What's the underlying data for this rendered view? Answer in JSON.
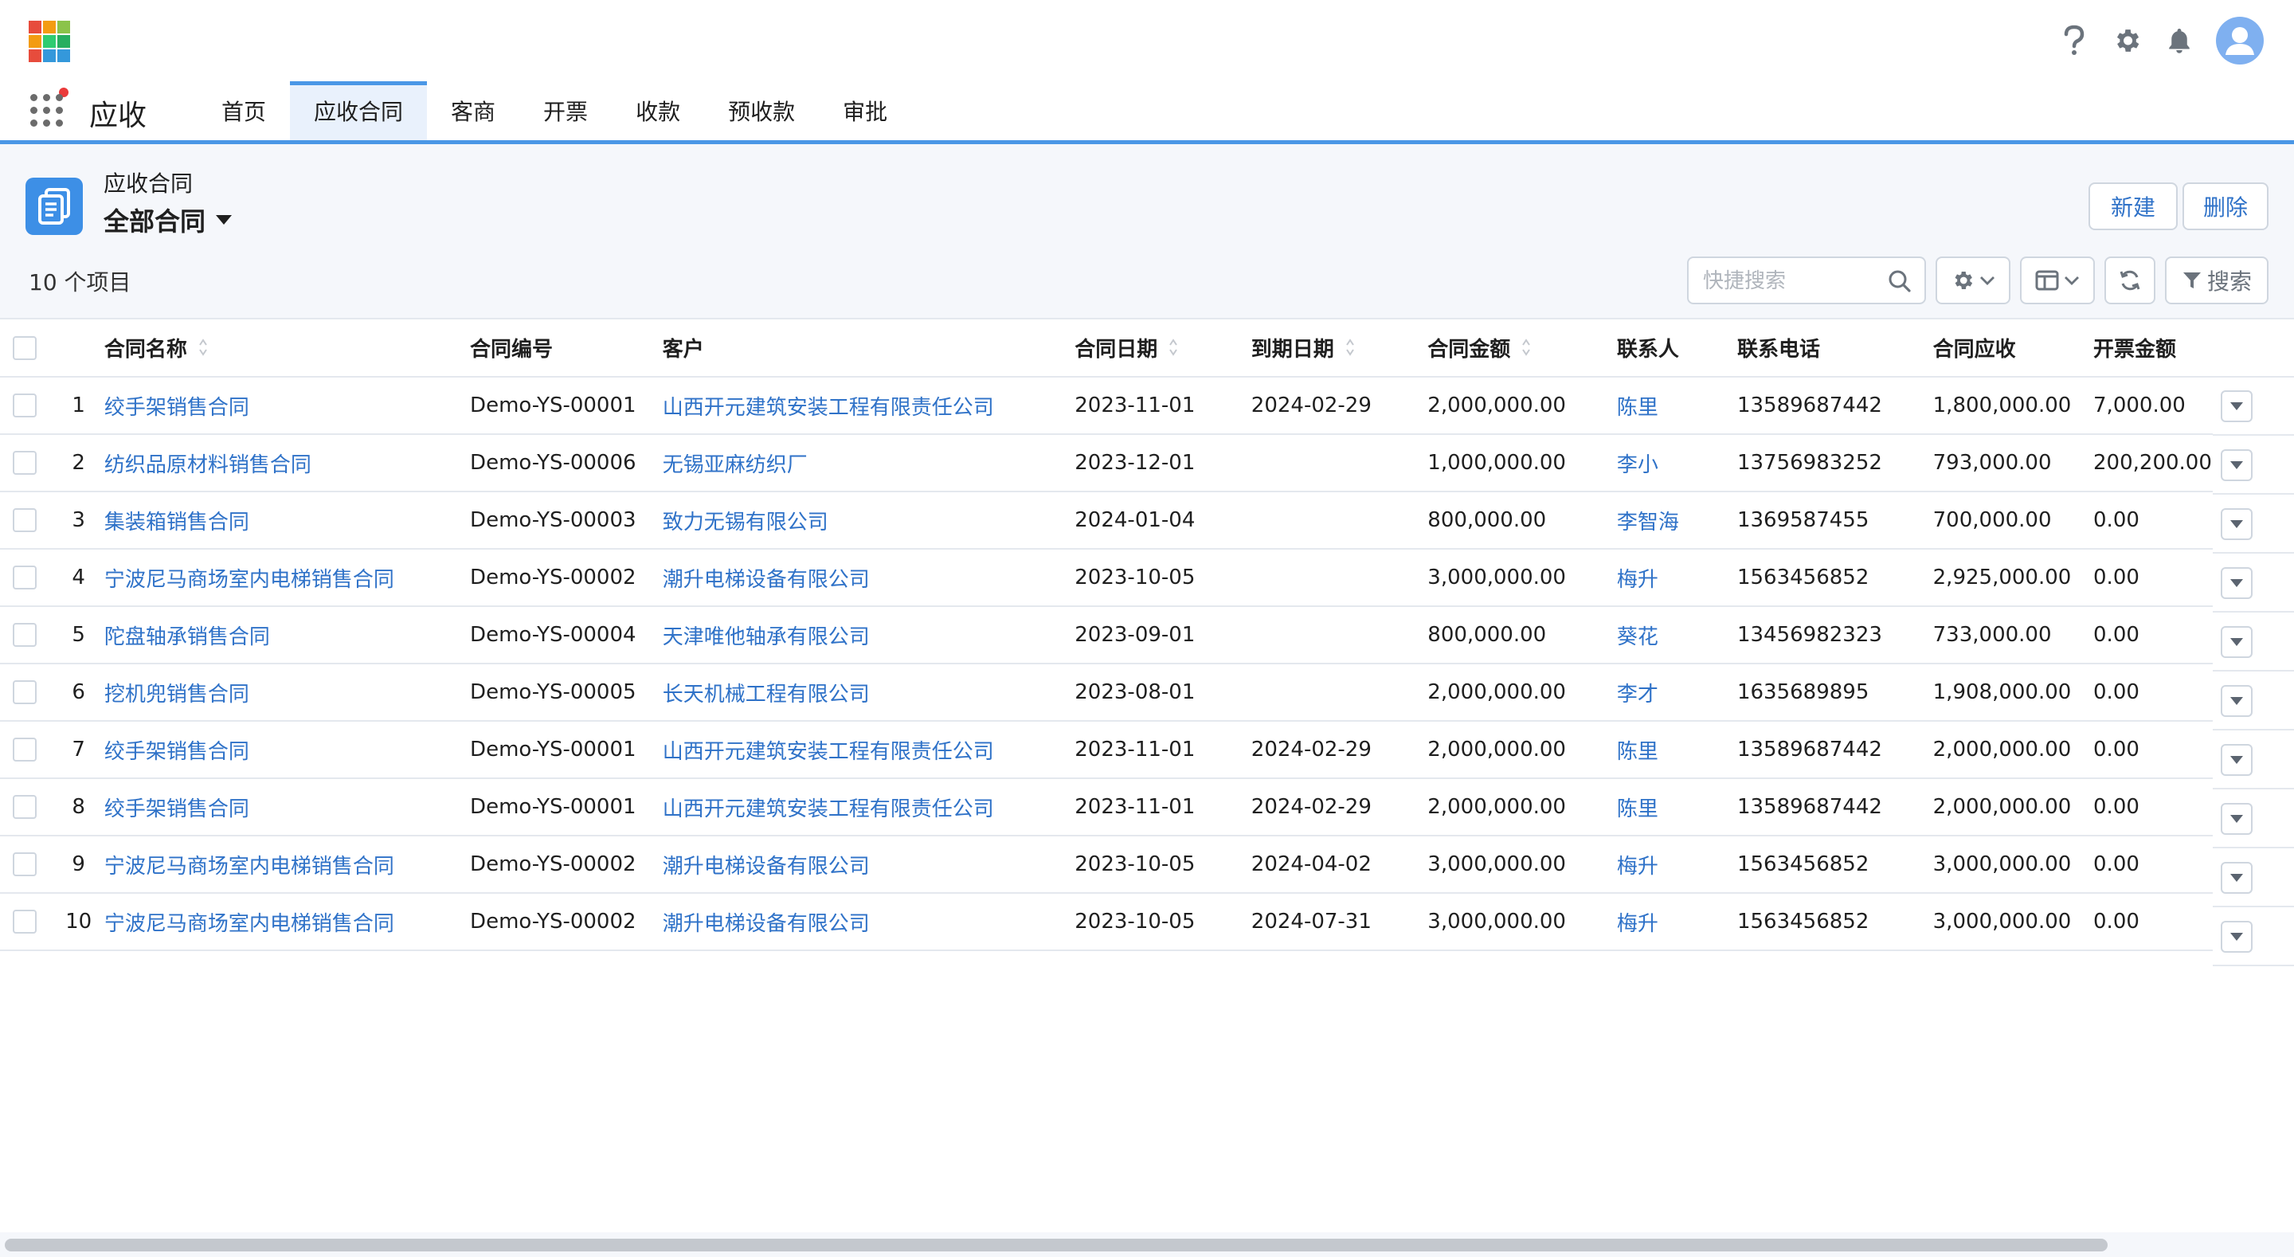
{
  "app": {
    "name": "应收",
    "logo_colors": [
      "#e74c3c",
      "#f39c12",
      "#8bc34a",
      "#f39c12",
      "#2ecc71",
      "#27ae60",
      "#e74c3c",
      "#3498db",
      "#3498db"
    ],
    "accent": "#4a97e6"
  },
  "header": {
    "icons": [
      "help-icon",
      "gear-icon",
      "bell-icon",
      "user-avatar-icon"
    ]
  },
  "tabs": [
    {
      "label": "首页",
      "active": false
    },
    {
      "label": "应收合同",
      "active": true
    },
    {
      "label": "客商",
      "active": false
    },
    {
      "label": "开票",
      "active": false
    },
    {
      "label": "收款",
      "active": false
    },
    {
      "label": "预收款",
      "active": false
    },
    {
      "label": "审批",
      "active": false
    }
  ],
  "page": {
    "object_type": "应收合同",
    "view_name": "全部合同",
    "item_count": "10 个项目",
    "new_label": "新建",
    "delete_label": "删除",
    "search_placeholder": "快捷搜索",
    "search_value": "",
    "filter_label": "搜索"
  },
  "table": {
    "columns": [
      "合同名称",
      "合同编号",
      "客户",
      "合同日期",
      "到期日期",
      "合同金额",
      "联系人",
      "联系电话",
      "合同应收",
      "开票金额"
    ],
    "sortable": [
      true,
      false,
      false,
      true,
      true,
      true,
      false,
      false,
      false,
      false
    ],
    "rows": [
      {
        "num": "1",
        "name": "绞手架销售合同",
        "code": "Demo-YS-00001",
        "customer": "山西开元建筑安装工程有限责任公司",
        "date": "2023-11-01",
        "due": "2024-02-29",
        "amount": "2,000,000.00",
        "contact": "陈里",
        "phone": "13589687442",
        "receivable": "1,800,000.00",
        "invoiced": "7,000.00"
      },
      {
        "num": "2",
        "name": "纺织品原材料销售合同",
        "code": "Demo-YS-00006",
        "customer": "无锡亚麻纺织厂",
        "date": "2023-12-01",
        "due": "",
        "amount": "1,000,000.00",
        "contact": "李小",
        "phone": "13756983252",
        "receivable": "793,000.00",
        "invoiced": "200,200.00"
      },
      {
        "num": "3",
        "name": "集装箱销售合同",
        "code": "Demo-YS-00003",
        "customer": "致力无锡有限公司",
        "date": "2024-01-04",
        "due": "",
        "amount": "800,000.00",
        "contact": "李智海",
        "phone": "1369587455",
        "receivable": "700,000.00",
        "invoiced": "0.00"
      },
      {
        "num": "4",
        "name": "宁波尼马商场室内电梯销售合同",
        "code": "Demo-YS-00002",
        "customer": "潮升电梯设备有限公司",
        "date": "2023-10-05",
        "due": "",
        "amount": "3,000,000.00",
        "contact": "梅升",
        "phone": "1563456852",
        "receivable": "2,925,000.00",
        "invoiced": "0.00"
      },
      {
        "num": "5",
        "name": "陀盘轴承销售合同",
        "code": "Demo-YS-00004",
        "customer": "天津唯他轴承有限公司",
        "date": "2023-09-01",
        "due": "",
        "amount": "800,000.00",
        "contact": "葵花",
        "phone": "13456982323",
        "receivable": "733,000.00",
        "invoiced": "0.00"
      },
      {
        "num": "6",
        "name": "挖机兜销售合同",
        "code": "Demo-YS-00005",
        "customer": "长天机械工程有限公司",
        "date": "2023-08-01",
        "due": "",
        "amount": "2,000,000.00",
        "contact": "李才",
        "phone": "1635689895",
        "receivable": "1,908,000.00",
        "invoiced": "0.00"
      },
      {
        "num": "7",
        "name": "绞手架销售合同",
        "code": "Demo-YS-00001",
        "customer": "山西开元建筑安装工程有限责任公司",
        "date": "2023-11-01",
        "due": "2024-02-29",
        "amount": "2,000,000.00",
        "contact": "陈里",
        "phone": "13589687442",
        "receivable": "2,000,000.00",
        "invoiced": "0.00"
      },
      {
        "num": "8",
        "name": "绞手架销售合同",
        "code": "Demo-YS-00001",
        "customer": "山西开元建筑安装工程有限责任公司",
        "date": "2023-11-01",
        "due": "2024-02-29",
        "amount": "2,000,000.00",
        "contact": "陈里",
        "phone": "13589687442",
        "receivable": "2,000,000.00",
        "invoiced": "0.00"
      },
      {
        "num": "9",
        "name": "宁波尼马商场室内电梯销售合同",
        "code": "Demo-YS-00002",
        "customer": "潮升电梯设备有限公司",
        "date": "2023-10-05",
        "due": "2024-04-02",
        "amount": "3,000,000.00",
        "contact": "梅升",
        "phone": "1563456852",
        "receivable": "3,000,000.00",
        "invoiced": "0.00"
      },
      {
        "num": "10",
        "name": "宁波尼马商场室内电梯销售合同",
        "code": "Demo-YS-00002",
        "customer": "潮升电梯设备有限公司",
        "date": "2023-10-05",
        "due": "2024-07-31",
        "amount": "3,000,000.00",
        "contact": "梅升",
        "phone": "1563456852",
        "receivable": "3,000,000.00",
        "invoiced": "0.00"
      }
    ]
  }
}
